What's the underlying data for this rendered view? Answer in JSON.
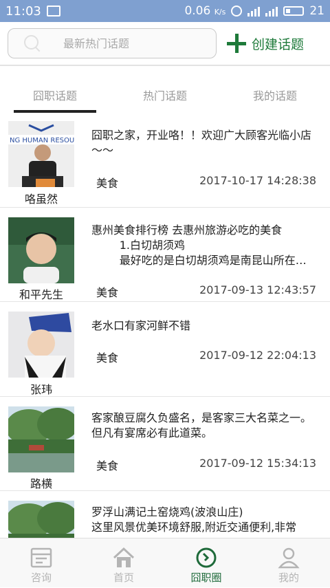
{
  "status_bar": {
    "time": "11:03",
    "speed": "0.06",
    "speed_unit": "K/s",
    "battery": "21"
  },
  "search": {
    "placeholder": "最新热门话题",
    "icon": "search-icon"
  },
  "create_button": {
    "label": "创建话题",
    "icon": "plus-icon",
    "color": "#1e7a3a"
  },
  "tabs": [
    {
      "label": "囧职话题",
      "selected": true
    },
    {
      "label": "热门话题",
      "selected": false
    },
    {
      "label": "我的话题",
      "selected": false
    }
  ],
  "topics": [
    {
      "author": "咯虽然",
      "title": "囧职之家，开业咯！！欢迎广大顾客光临小店～～",
      "category": "美食",
      "time": "2017-10-17 14:28:38",
      "avatar_banner": "NG HUMAN RESOURC"
    },
    {
      "author": "和平先生",
      "title": "惠州美食排行榜 去惠州旅游必吃的美食\n        1.白切胡须鸡\n        最好吃的是白切胡须鸡是南昆山所在…",
      "category": "美食",
      "time": "2017-09-13 12:43:57"
    },
    {
      "author": "张玮",
      "title": "老水口有家河鲜不错",
      "category": "美食",
      "time": "2017-09-12 22:04:13"
    },
    {
      "author": "路横",
      "title": "客家酿豆腐久负盛名，是客家三大名菜之一。但凡有宴席必有此道菜。",
      "category": "美食",
      "time": "2017-09-12 15:34:13"
    },
    {
      "author": "",
      "title": "罗浮山满记土窑烧鸡(波浪山庄)\n这里风景优美环境舒服,附近交通便利,非常",
      "category": "",
      "time": ""
    }
  ],
  "bottom_nav": [
    {
      "label": "咨询",
      "icon": "consult-icon",
      "active": false
    },
    {
      "label": "首页",
      "icon": "home-icon",
      "active": false
    },
    {
      "label": "囧职圈",
      "icon": "compass-icon",
      "active": true
    },
    {
      "label": "我的",
      "icon": "user-icon",
      "active": false
    }
  ]
}
